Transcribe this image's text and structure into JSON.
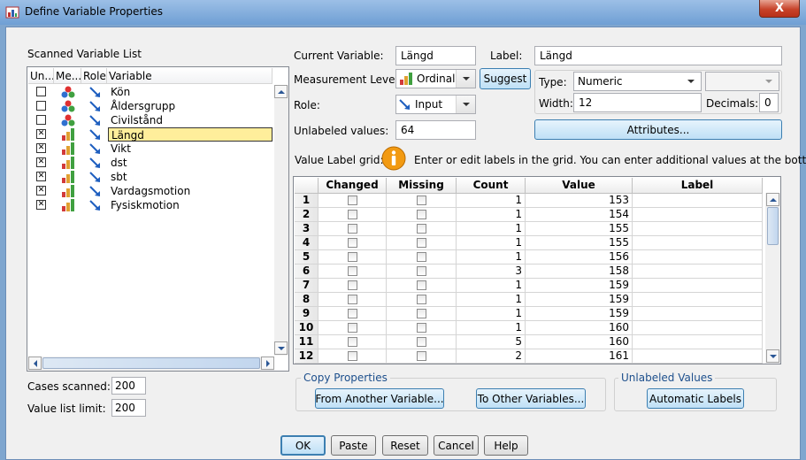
{
  "window": {
    "title": "Define Variable Properties",
    "close_label": "X"
  },
  "scanned_list": {
    "title": "Scanned Variable List",
    "columns": [
      "Un...",
      "Me...",
      "Role",
      "Variable"
    ],
    "rows": [
      {
        "name": "Kön",
        "checked": false,
        "measure": "nominal",
        "selected": false
      },
      {
        "name": "Åldersgrupp",
        "checked": false,
        "measure": "nominal",
        "selected": false
      },
      {
        "name": "Civilstånd",
        "checked": false,
        "measure": "nominal",
        "selected": false
      },
      {
        "name": "Längd",
        "checked": true,
        "measure": "ordinal",
        "selected": true
      },
      {
        "name": "Vikt",
        "checked": true,
        "measure": "ordinal",
        "selected": false
      },
      {
        "name": "dst",
        "checked": true,
        "measure": "ordinal",
        "selected": false
      },
      {
        "name": "sbt",
        "checked": true,
        "measure": "ordinal",
        "selected": false
      },
      {
        "name": "Vardagsmotion",
        "checked": true,
        "measure": "ordinal",
        "selected": false
      },
      {
        "name": "Fysiskmotion",
        "checked": true,
        "measure": "ordinal",
        "selected": false
      }
    ]
  },
  "cases": {
    "scanned_label": "Cases scanned:",
    "scanned_value": "200",
    "limit_label": "Value list limit:",
    "limit_value": "200"
  },
  "props": {
    "current_variable_label": "Current Variable:",
    "current_variable_value": "Längd",
    "label_label": "Label:",
    "label_value": "Längd",
    "measurement_label": "Measurement Level:",
    "measurement_value": "Ordinal",
    "suggest_label": "Suggest",
    "role_label": "Role:",
    "role_value": "Input",
    "unlabeled_label": "Unlabeled values:",
    "unlabeled_value": "64",
    "type_label": "Type:",
    "type_value": "Numeric",
    "width_label": "Width:",
    "width_value": "12",
    "decimals_label": "Decimals:",
    "decimals_value": "0",
    "attributes_label": "Attributes..."
  },
  "value_grid": {
    "label": "Value Label grid:",
    "info": "Enter or edit labels in the grid. You can enter additional values at the bottom.",
    "columns": [
      "Changed",
      "Missing",
      "Count",
      "Value",
      "Label"
    ],
    "rows": [
      {
        "n": "1",
        "count": "1",
        "value": "153"
      },
      {
        "n": "2",
        "count": "1",
        "value": "154"
      },
      {
        "n": "3",
        "count": "1",
        "value": "155"
      },
      {
        "n": "4",
        "count": "1",
        "value": "155"
      },
      {
        "n": "5",
        "count": "1",
        "value": "156"
      },
      {
        "n": "6",
        "count": "3",
        "value": "158"
      },
      {
        "n": "7",
        "count": "1",
        "value": "159"
      },
      {
        "n": "8",
        "count": "1",
        "value": "159"
      },
      {
        "n": "9",
        "count": "1",
        "value": "159"
      },
      {
        "n": "10",
        "count": "1",
        "value": "160"
      },
      {
        "n": "11",
        "count": "5",
        "value": "160"
      },
      {
        "n": "12",
        "count": "2",
        "value": "161"
      }
    ]
  },
  "copy_group": {
    "title": "Copy Properties",
    "from_label": "From Another Variable...",
    "to_label": "To Other Variables..."
  },
  "unlabeled_group": {
    "title": "Unlabeled Values",
    "auto_label": "Automatic Labels"
  },
  "footer": {
    "ok": "OK",
    "paste": "Paste",
    "reset": "Reset",
    "cancel": "Cancel",
    "help": "Help"
  }
}
